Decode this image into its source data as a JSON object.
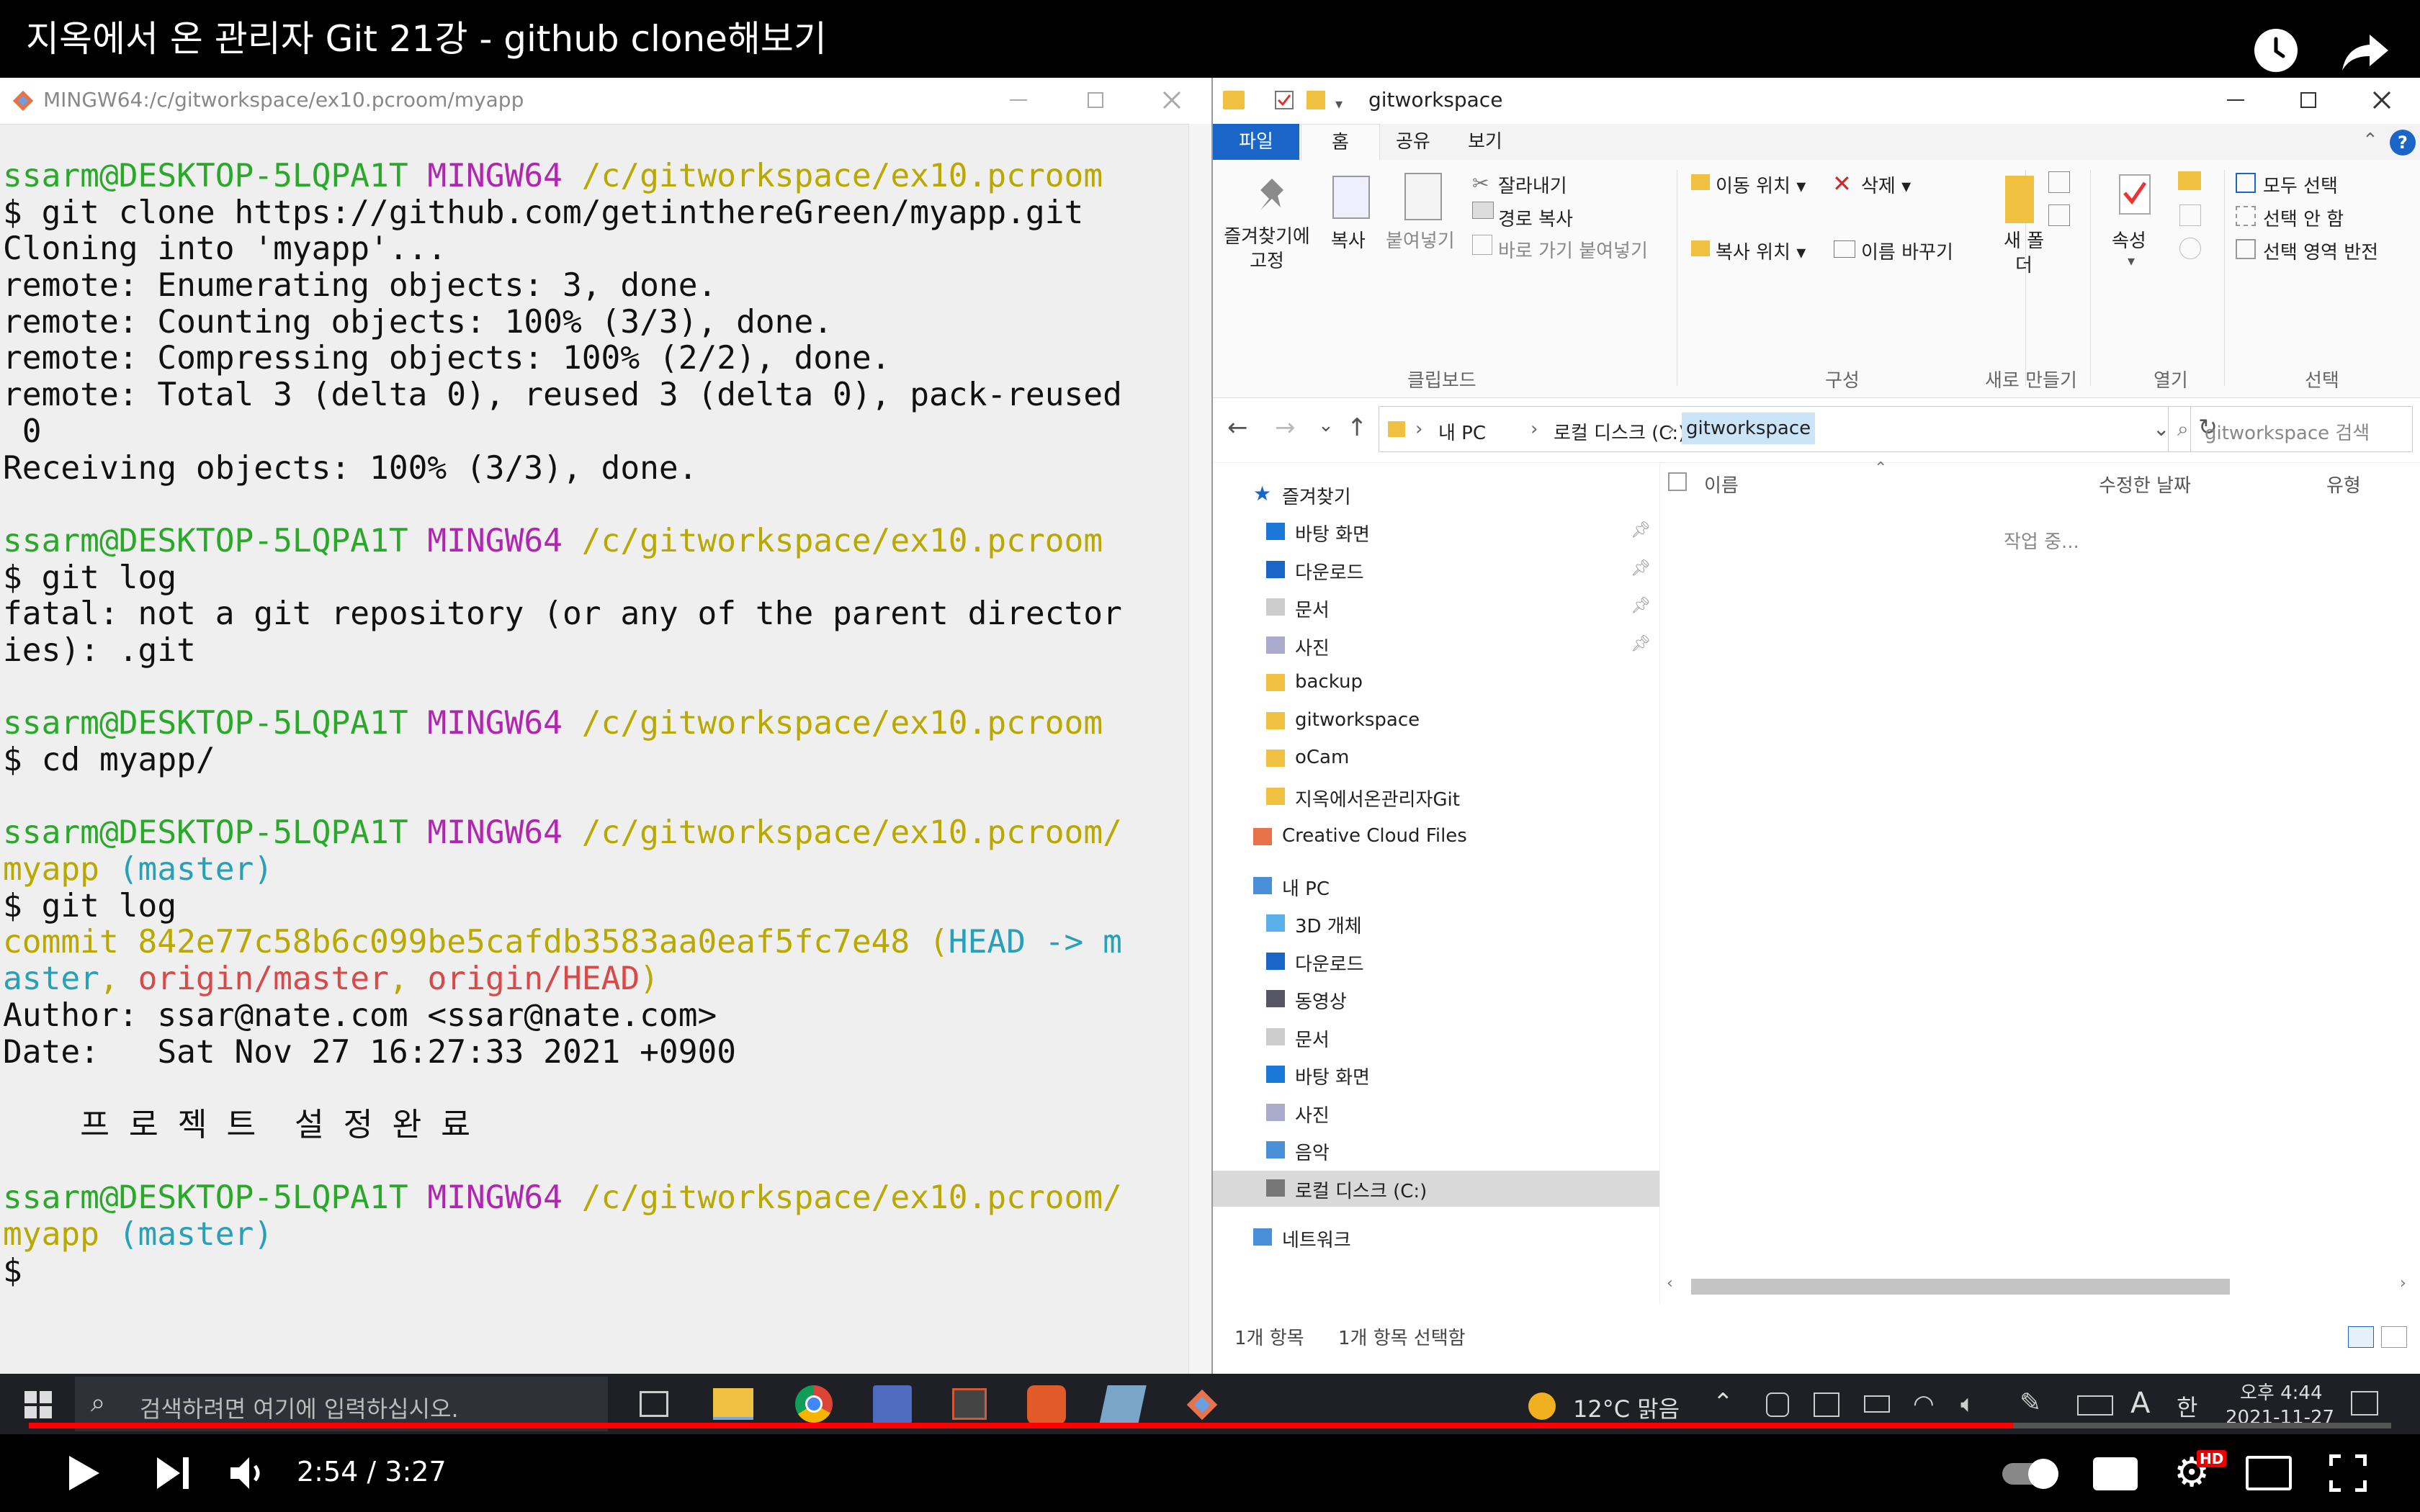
{
  "video": {
    "title": "지옥에서 온 관리자 Git 21강 - github clone해보기",
    "time": "2:54 / 3:27",
    "progress": 0.84,
    "hd_badge": "HD"
  },
  "terminal": {
    "title": "MINGW64:/c/gitworkspace/ex10.pcroom/myapp",
    "lines": [
      [
        {
          "t": "ssarm@DESKTOP-5LQPA1T ",
          "c": "g"
        },
        {
          "t": "MINGW64 ",
          "c": "m"
        },
        {
          "t": "/c/gitworkspace/ex10.pcroom",
          "c": "y"
        }
      ],
      [
        {
          "t": "$ git clone https://github.com/getinthereGreen/myapp.git",
          "c": ""
        }
      ],
      [
        {
          "t": "Cloning into 'myapp'...",
          "c": ""
        }
      ],
      [
        {
          "t": "remote: Enumerating objects: 3, done.",
          "c": ""
        }
      ],
      [
        {
          "t": "remote: Counting objects: 100% (3/3), done.",
          "c": ""
        }
      ],
      [
        {
          "t": "remote: Compressing objects: 100% (2/2), done.",
          "c": ""
        }
      ],
      [
        {
          "t": "remote: Total 3 (delta 0), reused 3 (delta 0), pack-reused",
          "c": ""
        }
      ],
      [
        {
          "t": " 0",
          "c": ""
        }
      ],
      [
        {
          "t": "Receiving objects: 100% (3/3), done.",
          "c": ""
        }
      ],
      [
        {
          "t": "",
          "c": ""
        }
      ],
      [
        {
          "t": "ssarm@DESKTOP-5LQPA1T ",
          "c": "g"
        },
        {
          "t": "MINGW64 ",
          "c": "m"
        },
        {
          "t": "/c/gitworkspace/ex10.pcroom",
          "c": "y"
        }
      ],
      [
        {
          "t": "$ git log",
          "c": ""
        }
      ],
      [
        {
          "t": "fatal: not a git repository (or any of the parent director",
          "c": ""
        }
      ],
      [
        {
          "t": "ies): .git",
          "c": ""
        }
      ],
      [
        {
          "t": "",
          "c": ""
        }
      ],
      [
        {
          "t": "ssarm@DESKTOP-5LQPA1T ",
          "c": "g"
        },
        {
          "t": "MINGW64 ",
          "c": "m"
        },
        {
          "t": "/c/gitworkspace/ex10.pcroom",
          "c": "y"
        }
      ],
      [
        {
          "t": "$ cd myapp/",
          "c": ""
        }
      ],
      [
        {
          "t": "",
          "c": ""
        }
      ],
      [
        {
          "t": "ssarm@DESKTOP-5LQPA1T ",
          "c": "g"
        },
        {
          "t": "MINGW64 ",
          "c": "m"
        },
        {
          "t": "/c/gitworkspace/ex10.pcroom/",
          "c": "y"
        }
      ],
      [
        {
          "t": "myapp ",
          "c": "y"
        },
        {
          "t": "(master)",
          "c": "c"
        }
      ],
      [
        {
          "t": "$ git log",
          "c": ""
        }
      ],
      [
        {
          "t": "commit 842e77c58b6c099be5cafdb3583aa0eaf5fc7e48 (",
          "c": "y"
        },
        {
          "t": "HEAD -> m",
          "c": "c"
        }
      ],
      [
        {
          "t": "aster",
          "c": "c"
        },
        {
          "t": ", ",
          "c": "y"
        },
        {
          "t": "origin/master",
          "c": "r"
        },
        {
          "t": ", ",
          "c": "y"
        },
        {
          "t": "origin/HEAD",
          "c": "r"
        },
        {
          "t": ")",
          "c": "y"
        }
      ],
      [
        {
          "t": "Author: ssar@nate.com <ssar@nate.com>",
          "c": ""
        }
      ],
      [
        {
          "t": "Date:   Sat Nov 27 16:27:33 2021 +0900",
          "c": ""
        }
      ],
      [
        {
          "t": "",
          "c": ""
        }
      ],
      [
        {
          "t": "    프 로 젝 트  설 정 완 료",
          "c": ""
        }
      ],
      [
        {
          "t": "",
          "c": ""
        }
      ],
      [
        {
          "t": "ssarm@DESKTOP-5LQPA1T ",
          "c": "g"
        },
        {
          "t": "MINGW64 ",
          "c": "m"
        },
        {
          "t": "/c/gitworkspace/ex10.pcroom/",
          "c": "y"
        }
      ],
      [
        {
          "t": "myapp ",
          "c": "y"
        },
        {
          "t": "(master)",
          "c": "c"
        }
      ],
      [
        {
          "t": "$ ",
          "c": ""
        }
      ]
    ]
  },
  "explorer": {
    "title": "gitworkspace",
    "ribbon_tabs": [
      "파일",
      "홈",
      "공유",
      "보기"
    ],
    "clipboard": {
      "pin": "즐겨찾기에 고정",
      "copy": "복사",
      "paste": "붙여넣기",
      "cut": "잘라내기",
      "copy_path": "경로 복사",
      "paste_shortcut": "바로 가기 붙여넣기",
      "group": "클립보드"
    },
    "organize": {
      "move_to": "이동 위치",
      "copy_to": "복사 위치",
      "delete": "삭제",
      "rename": "이름 바꾸기",
      "group": "구성"
    },
    "new": {
      "new_folder": "새 폴더",
      "group": "새로 만들기"
    },
    "open": {
      "properties": "속성",
      "group": "열기"
    },
    "select": {
      "select_all": "모두 선택",
      "select_none": "선택 안 함",
      "invert": "선택 영역 반전",
      "group": "선택"
    },
    "address": [
      "내 PC",
      "로컬 디스크 (C:)",
      "gitworkspace"
    ],
    "search_placeholder": "gitworkspace 검색",
    "columns": {
      "name": "이름",
      "modified": "수정한 날짜",
      "type": "유형"
    },
    "working_text": "작업 중...",
    "nav": {
      "quick": "즐겨찾기",
      "quick_items": [
        "바탕 화면",
        "다운로드",
        "문서",
        "사진",
        "backup",
        "gitworkspace",
        "oCam",
        "지옥에서온관리자Git"
      ],
      "cloud": "Creative Cloud Files",
      "pc": "내 PC",
      "pc_items": [
        "3D 개체",
        "다운로드",
        "동영상",
        "문서",
        "바탕 화면",
        "사진",
        "음악",
        "로컬 디스크 (C:)"
      ],
      "network": "네트워크"
    },
    "status": {
      "items": "1개 항목",
      "selected": "1개 항목 선택함"
    }
  },
  "taskbar": {
    "search_placeholder": "검색하려면 여기에 입력하십시오.",
    "weather": "12°C 맑음",
    "ime": "A",
    "ime2": "한",
    "time": "오후 4:44",
    "date": "2021-11-27"
  }
}
